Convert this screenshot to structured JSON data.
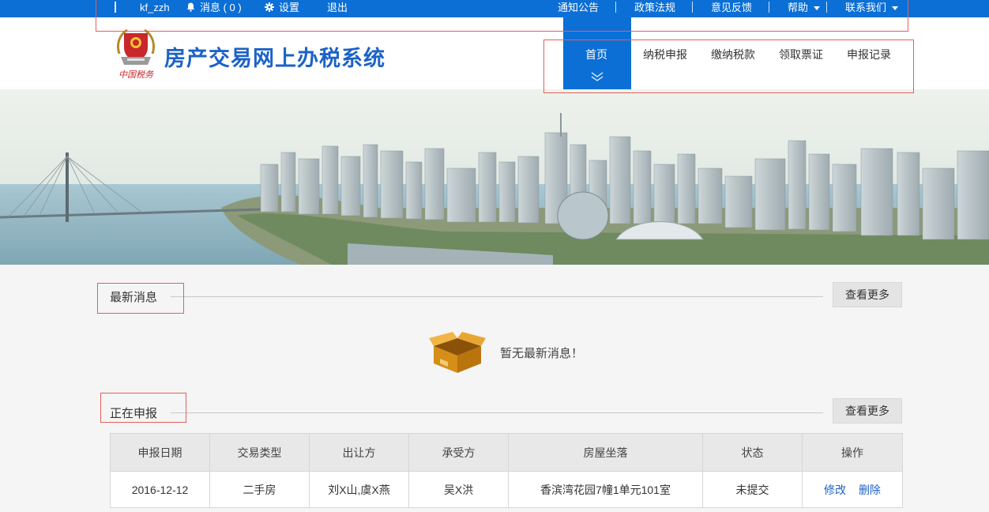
{
  "topbar": {
    "username": "kf_zzh",
    "messages_label": "消息 ( 0 )",
    "settings_label": "设置",
    "logout_label": "退出",
    "links": [
      "通知公告",
      "政策法规",
      "意见反馈",
      "帮助",
      "联系我们"
    ]
  },
  "header": {
    "logo_caption": "中国税务",
    "site_title": "房产交易网上办税系统",
    "nav": [
      "首页",
      "纳税申报",
      "缴纳税款",
      "领取票证",
      "申报记录"
    ]
  },
  "news": {
    "title": "最新消息",
    "more_label": "查看更多",
    "empty_text": "暂无最新消息！"
  },
  "declaring": {
    "title": "正在申报",
    "more_label": "查看更多",
    "columns": [
      "申报日期",
      "交易类型",
      "出让方",
      "承受方",
      "房屋坐落",
      "状态",
      "操作"
    ],
    "rows": [
      {
        "date": "2016-12-12",
        "type": "二手房",
        "seller": "刘X山,虞X燕",
        "buyer": "吴X洪",
        "location": "香滨湾花园7幢1单元101室",
        "status": "未提交",
        "edit_label": "修改",
        "delete_label": "删除"
      }
    ]
  },
  "colors": {
    "brand_blue": "#0b6fd6",
    "title_blue": "#1b62c8",
    "annotation_red": "#e2605a"
  }
}
